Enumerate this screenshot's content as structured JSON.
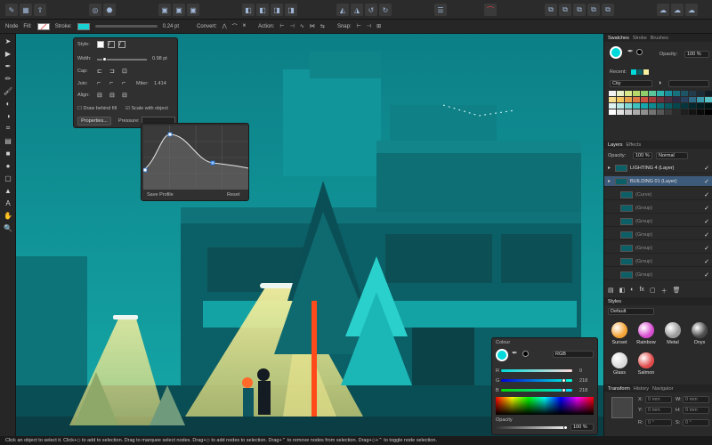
{
  "context": {
    "tool": "Node",
    "fill_label": "Fill:",
    "stroke_label": "Stroke:",
    "stroke_width": "0.24 pt",
    "convert_label": "Convert:",
    "action_label": "Action:",
    "snap_label": "Snap:"
  },
  "stroke_popup": {
    "style_label": "Style:",
    "width_label": "Width:",
    "width_value": "0.98 pt",
    "cap_label": "Cap:",
    "join_label": "Join:",
    "miter_label": "Miter:",
    "miter_value": "1.414",
    "align_label": "Align:",
    "draw_behind_fill": "Draw behind fill",
    "scale_with_object": "Scale with object",
    "properties_button": "Properties...",
    "pressure_label": "Pressure:"
  },
  "pressure_popup": {
    "save_profile": "Save Profile",
    "reset": "Reset"
  },
  "swatches": {
    "tabs": [
      "Swatches",
      "Stroke",
      "Brushes"
    ],
    "opacity_label": "Opacity:",
    "opacity_value": "100 %",
    "recent_label": "Recent:",
    "palette_name": "City",
    "colors": [
      "#f2f2f2",
      "#e9f0c7",
      "#d8e88a",
      "#b7d86b",
      "#8fcf6c",
      "#5cc49a",
      "#2fb2ad",
      "#1a8e9c",
      "#17707e",
      "#1e5566",
      "#233c4c",
      "#1c2a36",
      "#121a22",
      "#f6e08d",
      "#f2c75f",
      "#e6a24a",
      "#db7c44",
      "#c9523e",
      "#a23a3a",
      "#6f2f3a",
      "#4a2c3e",
      "#2f2a44",
      "#27415e",
      "#2f6b86",
      "#3a98ab",
      "#55c1c4",
      "#dff4f2",
      "#b6e8e4",
      "#7fd6d3",
      "#41c0c0",
      "#17a6ab",
      "#108a90",
      "#0c6f76",
      "#0a5960",
      "#08464d",
      "#06363c",
      "#04282d",
      "#021c20",
      "#011215",
      "#ffffff",
      "#e3e3e3",
      "#c7c7c7",
      "#ababab",
      "#8f8f8f",
      "#737373",
      "#575757",
      "#3b3b3b",
      "#2b2b2b",
      "#1f1f1f",
      "#141414",
      "#0a0a0a",
      "#000000"
    ]
  },
  "layers": {
    "tabs": [
      "Layers",
      "Effects"
    ],
    "opacity_label": "Opacity:",
    "opacity_value": "100 %",
    "blend_mode": "Normal",
    "items": [
      {
        "name": "LIGHTING 4",
        "kind": "(Layer)",
        "top": true
      },
      {
        "name": "BUILDING 01",
        "kind": "(Layer)",
        "top": true
      },
      {
        "name": "(Curve)",
        "kind": "",
        "top": false
      },
      {
        "name": "(Group)",
        "kind": "",
        "top": false
      },
      {
        "name": "(Group)",
        "kind": "",
        "top": false
      },
      {
        "name": "(Group)",
        "kind": "",
        "top": false
      },
      {
        "name": "(Group)",
        "kind": "",
        "top": false
      },
      {
        "name": "(Group)",
        "kind": "",
        "top": false
      },
      {
        "name": "(Group)",
        "kind": "",
        "top": false
      }
    ]
  },
  "styles": {
    "tab": "Styles",
    "category": "Default",
    "items": [
      {
        "label": "Sunset",
        "color": "#f4a334"
      },
      {
        "label": "Rainbow",
        "color": "#d74bd1"
      },
      {
        "label": "Metal",
        "color": "#9a9a9a"
      },
      {
        "label": "Onyx",
        "color": "#4a4a4a"
      },
      {
        "label": "Glass",
        "color": "#d9d9d9"
      },
      {
        "label": "Salmon",
        "color": "#e24b4b"
      }
    ]
  },
  "transform": {
    "tabs": [
      "Transform",
      "History",
      "Navigator"
    ],
    "x_label": "X:",
    "x_value": "0 mm",
    "y_label": "Y:",
    "y_value": "0 mm",
    "w_label": "W:",
    "w_value": "0 mm",
    "h_label": "H:",
    "h_value": "0 mm",
    "r_label": "R:",
    "r_value": "0 °",
    "s_label": "S:",
    "s_value": "0 °"
  },
  "colour": {
    "title": "Colour",
    "mode": "RGB",
    "r_label": "R",
    "r_value": "0",
    "g_label": "G",
    "g_value": "218",
    "b_label": "B",
    "b_value": "218",
    "opacity_label": "Opacity",
    "opacity_value": "100 %",
    "current_color": "#00dada"
  },
  "status": {
    "text": "Click an object to select it. Click+◇ to add to selection. Drag to marquee select nodes. Drag+◇ to add nodes to selection. Drag+⌃ to remove nodes from selection. Drag+◇+⌃ to toggle node selection."
  },
  "icons": {
    "move": "move-icon",
    "node": "node-icon",
    "pen": "pen-icon",
    "pencil": "pencil-icon",
    "brush": "brush-icon",
    "fill": "fill-icon",
    "shape": "shape-icon",
    "text": "text-icon",
    "hand": "hand-icon",
    "zoom": "zoom-icon"
  }
}
